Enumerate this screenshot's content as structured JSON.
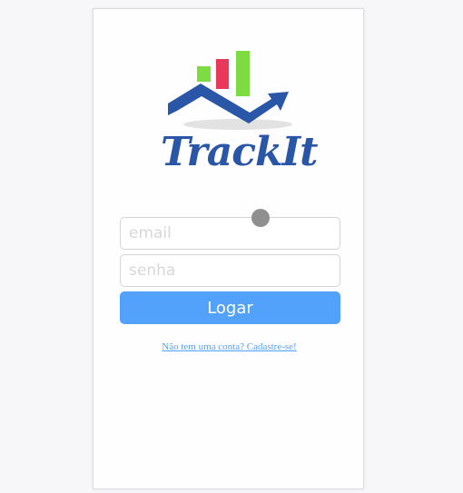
{
  "app": {
    "logo_text": "TrackIt"
  },
  "form": {
    "email_placeholder": "email",
    "password_placeholder": "senha",
    "submit_label": "Logar",
    "signup_link": "Não tem uma conta? Cadastre-se!"
  },
  "colors": {
    "brand_blue": "#2a56a7",
    "button_blue": "#52a2fc",
    "bar_green": "#7ddc42",
    "bar_red": "#e8395a"
  }
}
